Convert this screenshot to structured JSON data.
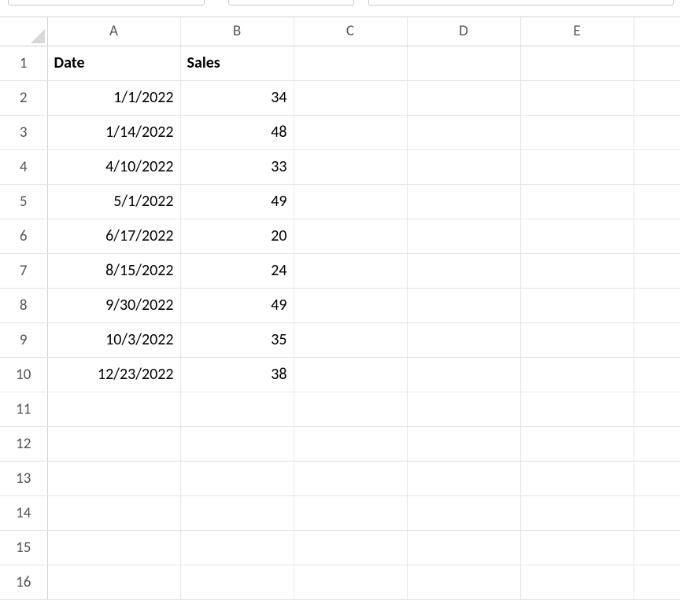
{
  "columns": [
    "A",
    "B",
    "C",
    "D",
    "E"
  ],
  "column_widths": [
    "169px",
    "144px",
    "144px",
    "144px",
    "144px"
  ],
  "row_count": 16,
  "headers": {
    "A": {
      "text": "Date",
      "bold": true,
      "align": "left"
    },
    "B": {
      "text": "Sales",
      "bold": true,
      "align": "left"
    }
  },
  "rows": [
    {
      "A": "1/1/2022",
      "B": "34"
    },
    {
      "A": "1/14/2022",
      "B": "48"
    },
    {
      "A": "4/10/2022",
      "B": "33"
    },
    {
      "A": "5/1/2022",
      "B": "49"
    },
    {
      "A": "6/17/2022",
      "B": "20"
    },
    {
      "A": "8/15/2022",
      "B": "24"
    },
    {
      "A": "9/30/2022",
      "B": "49"
    },
    {
      "A": "10/3/2022",
      "B": "35"
    },
    {
      "A": "12/23/2022",
      "B": "38"
    }
  ],
  "data_align": {
    "A": "right",
    "B": "right"
  }
}
